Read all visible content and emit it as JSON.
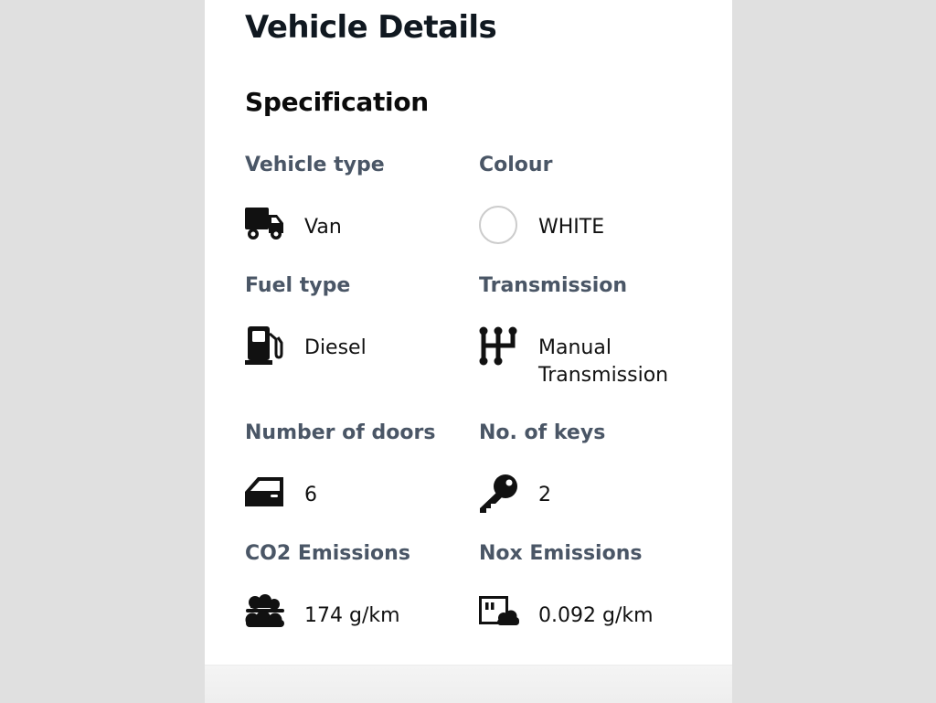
{
  "page": {
    "title": "Vehicle Details",
    "section_title": "Specification"
  },
  "specs": [
    {
      "label": "Vehicle type",
      "value": "Van",
      "icon": "van-icon"
    },
    {
      "label": "Colour",
      "value": "WHITE",
      "icon": "color-swatch-icon",
      "swatch_color": "#ffffff"
    },
    {
      "label": "Fuel type",
      "value": "Diesel",
      "icon": "fuel-pump-icon"
    },
    {
      "label": "Transmission",
      "value": "Manual Transmission",
      "icon": "gear-shift-icon"
    },
    {
      "label": "Number of doors",
      "value": "6",
      "icon": "car-door-icon"
    },
    {
      "label": "No. of keys",
      "value": "2",
      "icon": "key-icon"
    },
    {
      "label": "CO2 Emissions",
      "value": "174 g/km",
      "icon": "cloud-emissions-icon"
    },
    {
      "label": "Nox Emissions",
      "value": "0.092 g/km",
      "icon": "nox-emissions-icon"
    }
  ],
  "colors": {
    "background": "#e0e0e0",
    "panel": "#ffffff",
    "label": "#4a5666",
    "text": "#111111"
  }
}
